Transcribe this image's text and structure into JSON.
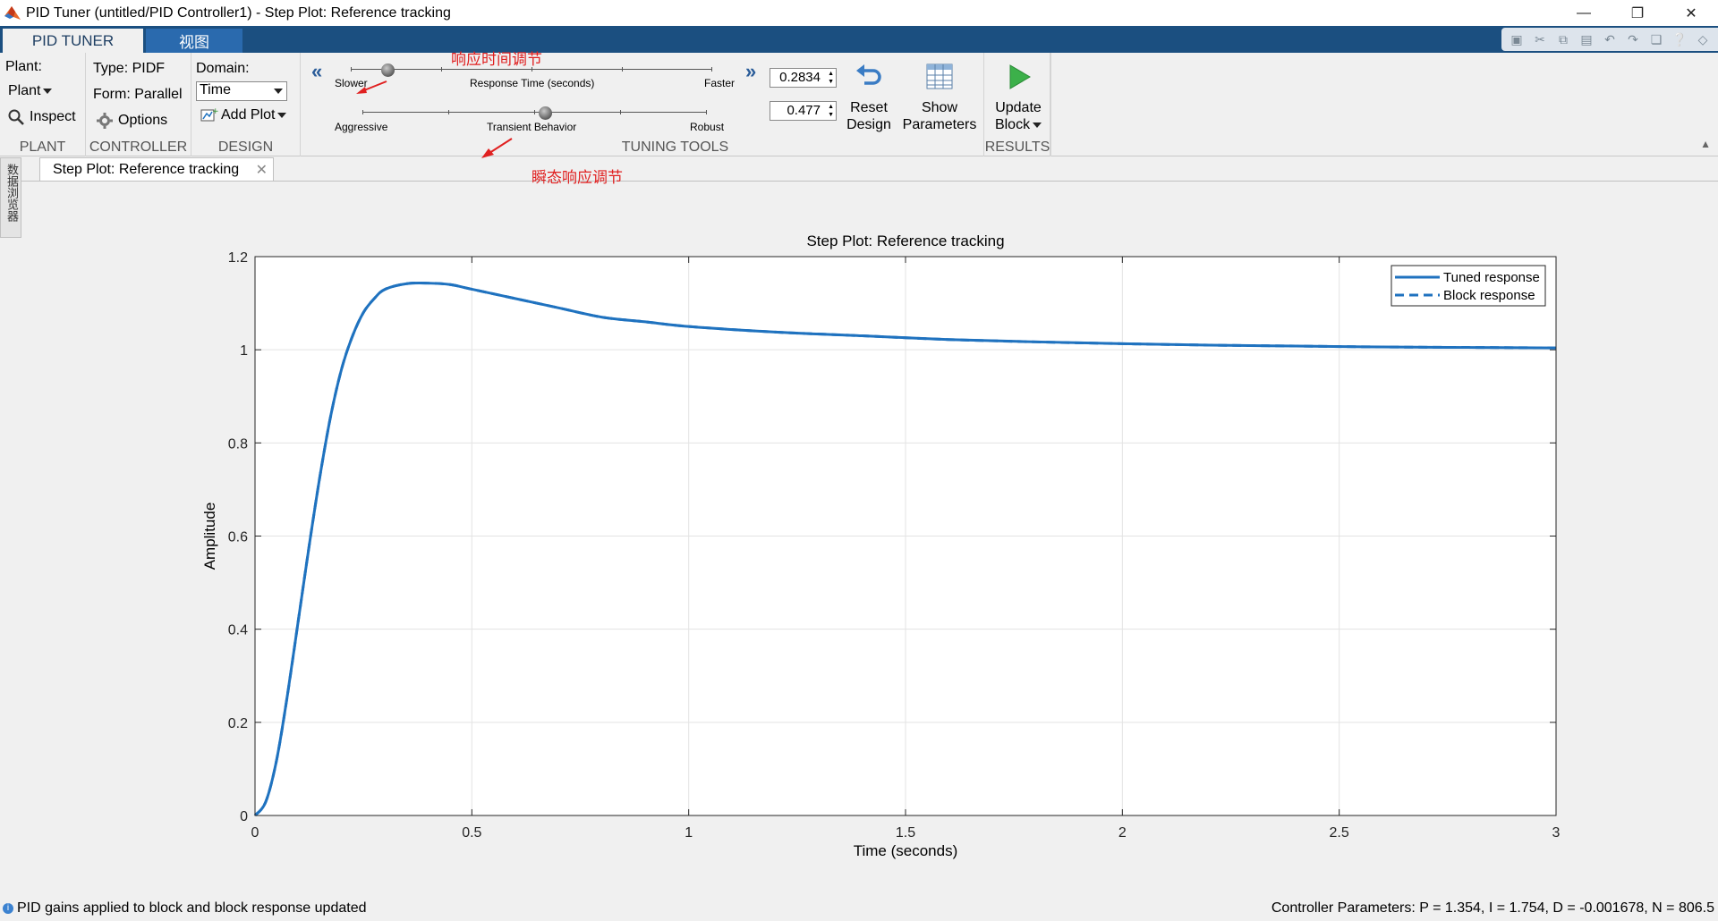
{
  "window": {
    "title": "PID Tuner (untitled/PID Controller1) - Step Plot: Reference tracking",
    "controls": [
      "minimize-icon",
      "restore-icon",
      "close-icon"
    ]
  },
  "tabs": [
    {
      "label": "PID TUNER",
      "active": true
    },
    {
      "label": "视图",
      "active": false
    }
  ],
  "ribbon": {
    "plant": {
      "label": "Plant:",
      "dropdown": "Plant",
      "inspect": "Inspect",
      "section": "PLANT"
    },
    "controller": {
      "type": "Type: PIDF",
      "form": "Form: Parallel",
      "options": "Options",
      "section": "CONTROLLER"
    },
    "design": {
      "domain_label": "Domain:",
      "domain_value": "Time",
      "add_plot": "Add Plot",
      "section": "DESIGN"
    },
    "tuning": {
      "response_slider": {
        "left": "Slower",
        "center": "Response Time (seconds)",
        "right": "Faster",
        "value": "0.2834"
      },
      "transient_slider": {
        "left": "Aggressive",
        "center": "Transient Behavior",
        "right": "Robust",
        "value": "0.477"
      },
      "reset_label": [
        "Reset",
        "Design"
      ],
      "show_params_label": [
        "Show",
        "Parameters"
      ],
      "section": "TUNING TOOLS"
    },
    "results": {
      "update_label": [
        "Update",
        "Block"
      ],
      "section": "RESULTS"
    }
  },
  "annotations": {
    "response_time": "响应时间调节",
    "transient": "瞬态响应调节"
  },
  "side_panel": {
    "label": "数据浏览器"
  },
  "document_tab": {
    "label": "Step Plot: Reference tracking"
  },
  "chart_data": {
    "type": "line",
    "title": "Step Plot: Reference tracking",
    "xlabel": "Time (seconds)",
    "ylabel": "Amplitude",
    "xlim": [
      0,
      3
    ],
    "ylim": [
      0,
      1.2
    ],
    "xticks": [
      0,
      0.5,
      1,
      1.5,
      2,
      2.5,
      3
    ],
    "xtick_labels": [
      "0",
      "0.5",
      "1",
      "1.5",
      "2",
      "2.5",
      "3"
    ],
    "yticks": [
      0,
      0.2,
      0.4,
      0.6,
      0.8,
      1,
      1.2
    ],
    "ytick_labels": [
      "0",
      "0.2",
      "0.4",
      "0.6",
      "0.8",
      "1",
      "1.2"
    ],
    "grid": true,
    "legend_position": "top-right",
    "series": [
      {
        "name": "Tuned response",
        "style": "solid",
        "color": "#1f72bf",
        "x": [
          0,
          0.025,
          0.05,
          0.075,
          0.1,
          0.125,
          0.15,
          0.175,
          0.2,
          0.225,
          0.25,
          0.275,
          0.3,
          0.35,
          0.4,
          0.45,
          0.5,
          0.6,
          0.7,
          0.8,
          0.9,
          1.0,
          1.2,
          1.4,
          1.6,
          1.8,
          2.0,
          2.2,
          2.4,
          2.6,
          2.8,
          3.0
        ],
        "y": [
          0,
          0.03,
          0.12,
          0.26,
          0.42,
          0.58,
          0.73,
          0.86,
          0.96,
          1.03,
          1.08,
          1.11,
          1.13,
          1.142,
          1.143,
          1.14,
          1.13,
          1.11,
          1.09,
          1.07,
          1.06,
          1.05,
          1.038,
          1.03,
          1.022,
          1.017,
          1.013,
          1.01,
          1.008,
          1.006,
          1.005,
          1.004
        ]
      },
      {
        "name": "Block response",
        "style": "dashed",
        "color": "#1f72bf",
        "x": [
          0,
          0.025,
          0.05,
          0.075,
          0.1,
          0.125,
          0.15,
          0.175,
          0.2,
          0.225,
          0.25,
          0.275,
          0.3,
          0.35,
          0.4,
          0.45,
          0.5,
          0.6,
          0.7,
          0.8,
          0.9,
          1.0,
          1.2,
          1.4,
          1.6,
          1.8,
          2.0,
          2.2,
          2.4,
          2.6,
          2.8,
          3.0
        ],
        "y": [
          0,
          0.03,
          0.12,
          0.26,
          0.42,
          0.58,
          0.73,
          0.86,
          0.96,
          1.03,
          1.08,
          1.11,
          1.13,
          1.142,
          1.143,
          1.14,
          1.13,
          1.11,
          1.09,
          1.07,
          1.06,
          1.05,
          1.038,
          1.03,
          1.022,
          1.017,
          1.013,
          1.01,
          1.008,
          1.006,
          1.005,
          1.004
        ]
      }
    ]
  },
  "status": {
    "left": "PID gains applied to block and block response updated",
    "right": "Controller Parameters: P = 1.354, I = 1.754, D = -0.001678, N = 806.5"
  }
}
